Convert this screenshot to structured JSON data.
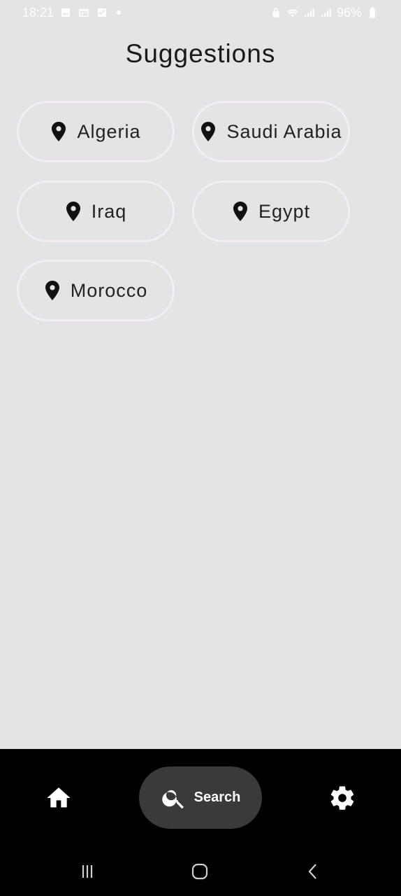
{
  "status_bar": {
    "time": "18:21",
    "battery": "96%",
    "left_icons": [
      "image-icon",
      "calendar-icon",
      "checkbox-icon",
      "dot-icon"
    ],
    "right_icons": [
      "lock-icon",
      "wifi-icon",
      "signal-icon",
      "signal-icon",
      "battery-icon"
    ]
  },
  "page": {
    "title": "Suggestions"
  },
  "suggestions": [
    {
      "label": "Algeria",
      "icon": "location-pin-icon"
    },
    {
      "label": "Saudi Arabia",
      "icon": "location-pin-icon"
    },
    {
      "label": "Iraq",
      "icon": "location-pin-icon"
    },
    {
      "label": "Egypt",
      "icon": "location-pin-icon"
    },
    {
      "label": "Morocco",
      "icon": "location-pin-icon"
    }
  ],
  "bottom_nav": {
    "home_icon": "home-icon",
    "search_label": "Search",
    "search_icon": "search-icon",
    "settings_icon": "gear-icon",
    "active": "search"
  },
  "system_nav": {
    "buttons": [
      "recents-icon",
      "home-circle-icon",
      "back-icon"
    ]
  },
  "colors": {
    "background": "#e4e4e5",
    "chip_border": "#f4eef6",
    "nav_background": "#000000",
    "active_pill": "#3a3a3a"
  }
}
